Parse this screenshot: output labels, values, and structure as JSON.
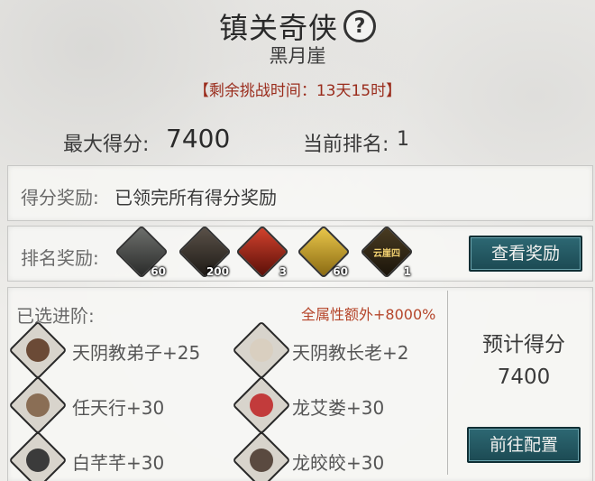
{
  "title": "镇关奇侠",
  "subtitle": "黑月崖",
  "timer": "【剩余挑战时间：13天15时】",
  "stats": {
    "max_score_label": "最大得分:",
    "max_score_value": "7400",
    "rank_label": "当前排名:",
    "rank_value": "1"
  },
  "score_reward": {
    "label": "得分奖励:",
    "text": "已领完所有得分奖励"
  },
  "rank_reward": {
    "label": "排名奖励:",
    "items": [
      {
        "icon": "feather-bundle-icon",
        "count": "60"
      },
      {
        "icon": "badge-token-icon",
        "count": "200"
      },
      {
        "icon": "red-ore-icon",
        "count": "3"
      },
      {
        "icon": "gold-book-icon",
        "count": "60"
      },
      {
        "icon": "title-plaque-icon",
        "count": "1",
        "plaque_text": "云崖四"
      }
    ],
    "button": "查看奖励"
  },
  "advance": {
    "label": "已选进阶:",
    "bonus": "全属性额外+8000%",
    "characters": [
      {
        "name": "天阴教弟子+25"
      },
      {
        "name": "天阴教长老+2"
      },
      {
        "name": "任天行+30"
      },
      {
        "name": "龙艾娄+30"
      },
      {
        "name": "白芊芊+30"
      },
      {
        "name": "龙皎皎+30"
      }
    ]
  },
  "projection": {
    "label": "预计得分",
    "value": "7400",
    "button": "前往配置"
  },
  "colors": {
    "timer": "#9a2c1c",
    "bonus": "#b5452a",
    "button": "#1c4a53"
  }
}
